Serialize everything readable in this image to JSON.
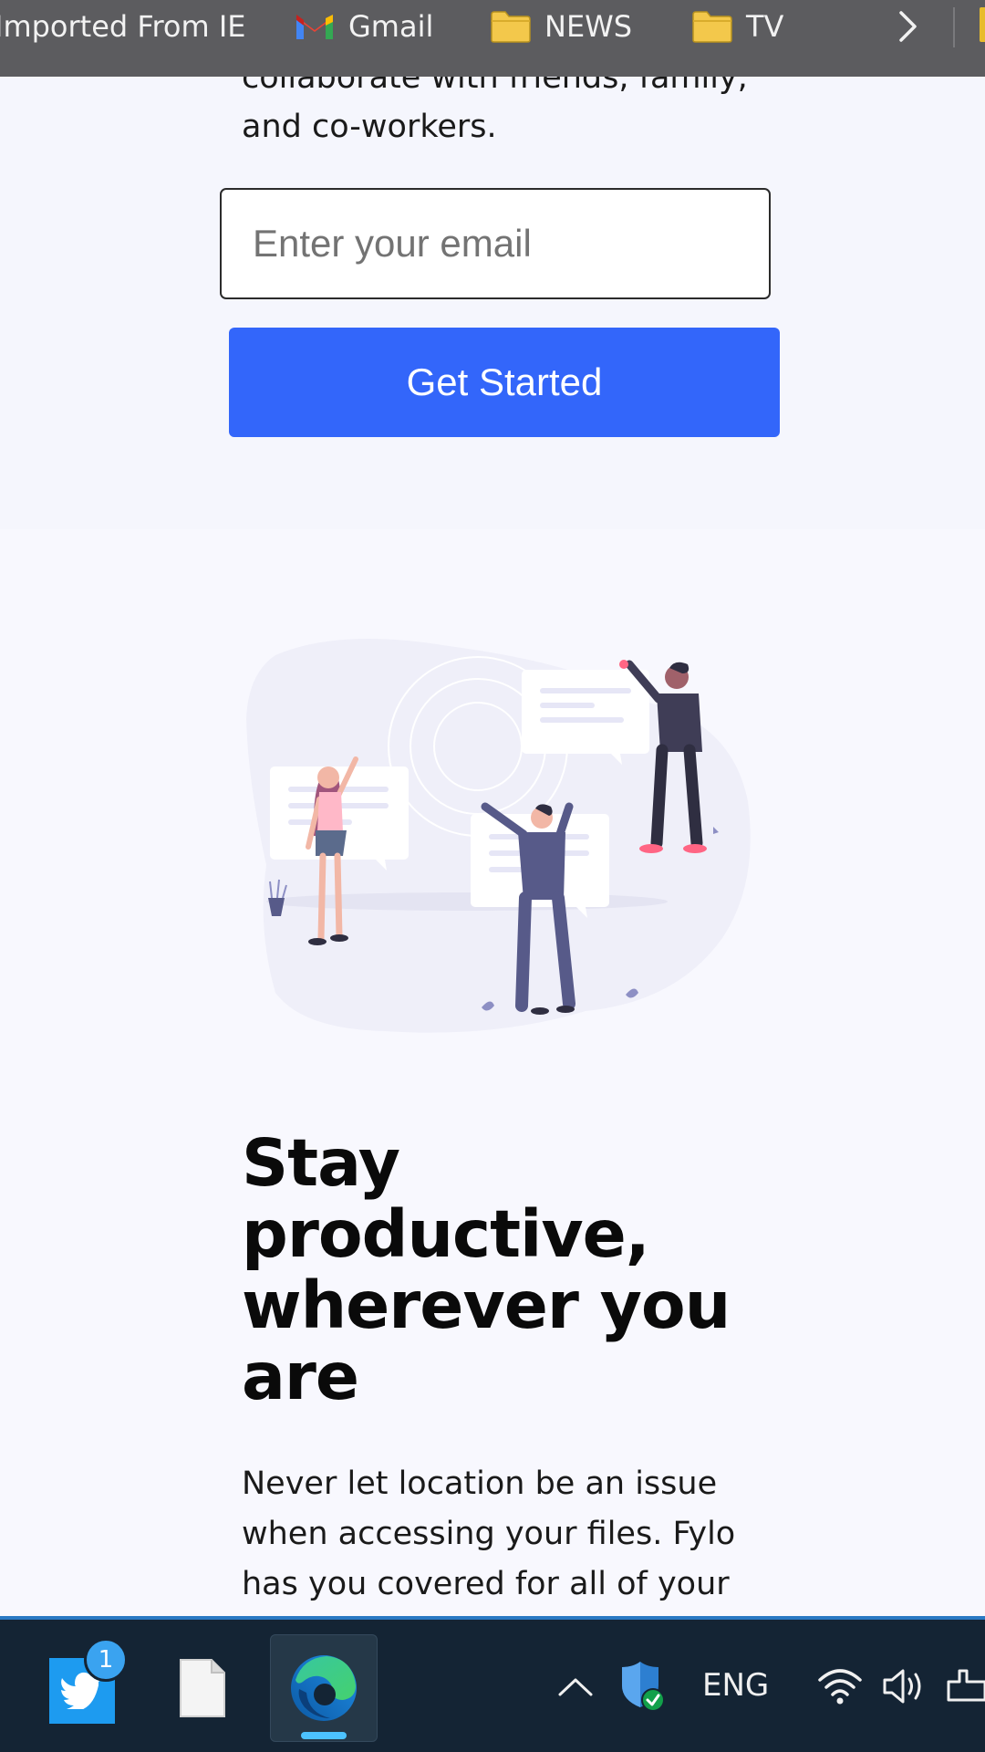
{
  "bookmarks_bar": {
    "items": [
      {
        "label": "Imported From IE",
        "icon": "none"
      },
      {
        "label": "Gmail",
        "icon": "gmail-icon"
      },
      {
        "label": "NEWS",
        "icon": "folder-icon"
      },
      {
        "label": "TV",
        "icon": "folder-icon"
      }
    ],
    "overflow_icon": "chevron-right-icon"
  },
  "hero": {
    "intro_text": "collaborate with friends, family, and co-workers.",
    "email_placeholder": "Enter your email",
    "email_value": "",
    "cta_label": "Get Started",
    "cta_color": "#3366fa"
  },
  "productive_section": {
    "illustration": "people-with-speech-bubbles-illustration",
    "heading": "Stay productive, wherever you are",
    "body": "Never let location be an issue when accessing your files. Fylo has you covered for all of your"
  },
  "taskbar": {
    "apps": [
      {
        "name": "twitter-icon",
        "badge": "1"
      },
      {
        "name": "file-icon"
      },
      {
        "name": "edge-icon",
        "active": true
      }
    ],
    "tray": {
      "language": "ENG",
      "icons": [
        "chevron-up-icon",
        "security-shield-icon",
        "wifi-icon",
        "volume-icon",
        "notification-icon"
      ]
    },
    "accent": "#2a79c4"
  }
}
